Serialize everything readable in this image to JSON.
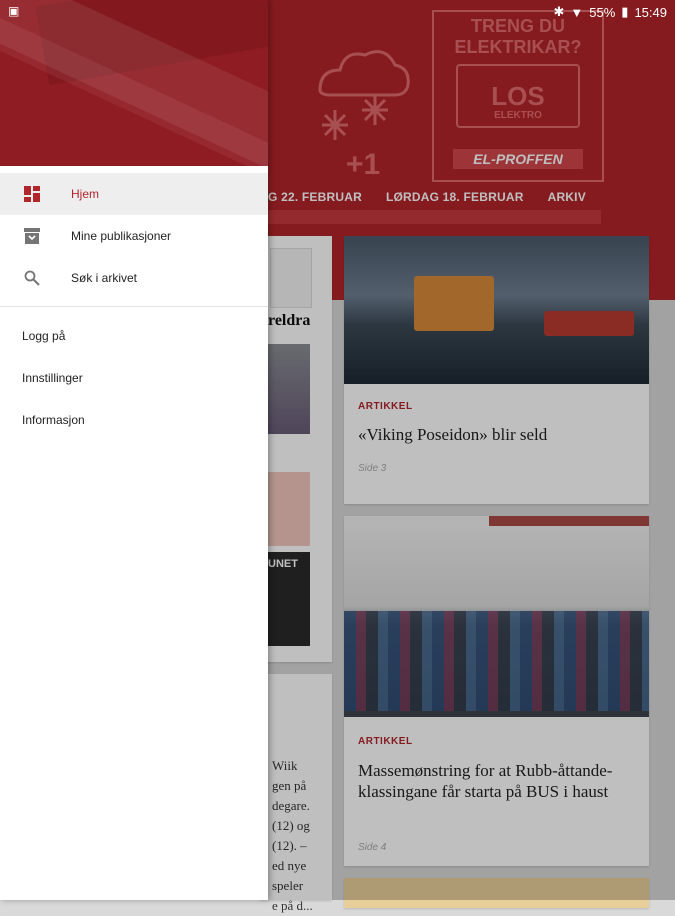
{
  "status_bar": {
    "battery": "55%",
    "time": "15:49"
  },
  "weather": {
    "temperature": "+1"
  },
  "ad": {
    "line1": "TRENG DU",
    "line2": "ELEKTRIKAR?",
    "logo": "LOS",
    "logo_sub": "ELEKTRO",
    "bar": "EL-PROFFEN"
  },
  "tabs": [
    {
      "label": "G 22. FEBRUAR"
    },
    {
      "label": "LØRDAG 18. FEBRUAR"
    },
    {
      "label": "ARKIV"
    }
  ],
  "articles": [
    {
      "kicker": "ARTIKKEL",
      "headline": "«Viking Poseidon» blir seld",
      "page": "Side 3"
    },
    {
      "kicker": "ARTIKKEL",
      "headline": "Massemønstring for at Rubb-åttande-klassingane får starta på BUS i haust",
      "page": "Side 4"
    }
  ],
  "left_card": {
    "title_fragment": "reldra",
    "unet": "UNET"
  },
  "text_fragments": [
    "Wiik",
    "gen på",
    "degare.",
    "(12) og",
    "(12). –",
    "ed nye",
    "speler",
    "e på d..."
  ],
  "drawer": {
    "nav": [
      {
        "label": "Hjem",
        "icon": "dashboard-icon"
      },
      {
        "label": "Mine publikasjoner",
        "icon": "publications-icon"
      },
      {
        "label": "Søk i arkivet",
        "icon": "search-icon"
      }
    ],
    "secondary": [
      {
        "label": "Logg på"
      },
      {
        "label": "Innstillinger"
      },
      {
        "label": "Informasjon"
      }
    ]
  },
  "colors": {
    "brand": "#b2252a",
    "drawer_header": "#8f1c22"
  }
}
